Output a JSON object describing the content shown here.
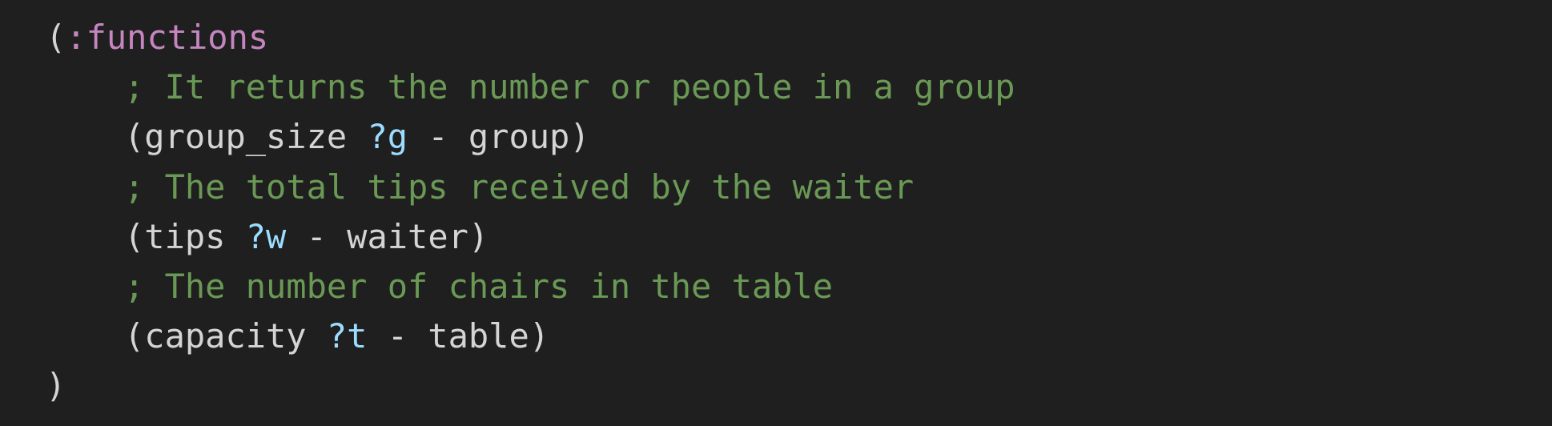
{
  "colors": {
    "background": "#1f1f1f",
    "text": "#d4d4d4",
    "keyword": "#c586c0",
    "comment": "#6a9955",
    "variable": "#9cdcfe"
  },
  "code": {
    "open": {
      "paren": "(",
      "keyword": ":functions"
    },
    "comment1": "; It returns the number or people in a group",
    "fn1": {
      "open": "(",
      "name": "group_size ",
      "var": "?g",
      "rest": " - group",
      "close": ")"
    },
    "comment2": "; The total tips received by the waiter",
    "fn2": {
      "open": "(",
      "name": "tips ",
      "var": "?w",
      "rest": " - waiter",
      "close": ")"
    },
    "comment3": "; The number of chairs in the table",
    "fn3": {
      "open": "(",
      "name": "capacity ",
      "var": "?t",
      "rest": " - table",
      "close": ")"
    },
    "close": ")"
  }
}
